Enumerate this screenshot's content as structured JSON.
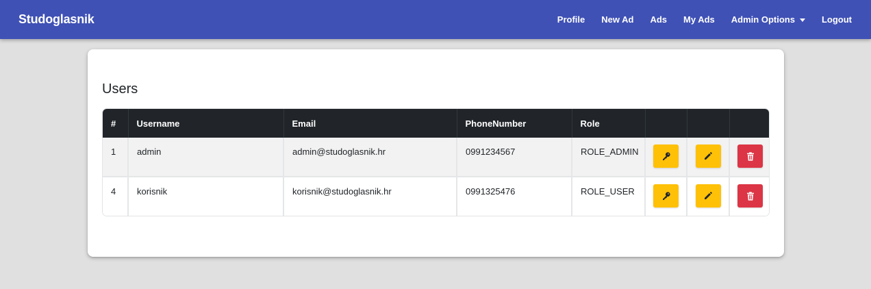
{
  "navbar": {
    "brand": "Studoglasnik",
    "links": [
      {
        "label": "Profile"
      },
      {
        "label": "New Ad"
      },
      {
        "label": "Ads"
      },
      {
        "label": "My Ads"
      },
      {
        "label": "Admin Options"
      },
      {
        "label": "Logout"
      }
    ],
    "color": "#3f51b5"
  },
  "page": {
    "title": "Users"
  },
  "table": {
    "headers": [
      "#",
      "Username",
      "Email",
      "PhoneNumber",
      "Role",
      "",
      "",
      ""
    ],
    "rows": [
      {
        "id": "1",
        "username": "admin",
        "email": "admin@studoglasnik.hr",
        "phone": "0991234567",
        "role": "ROLE_ADMIN"
      },
      {
        "id": "4",
        "username": "korisnik",
        "email": "korisnik@studoglasnik.hr",
        "phone": "0991325476",
        "role": "ROLE_USER"
      }
    ],
    "actions": [
      {
        "icon": "key-icon",
        "color": "#ffc107"
      },
      {
        "icon": "pencil-icon",
        "color": "#ffc107"
      },
      {
        "icon": "trash-icon",
        "color": "#dc3545"
      }
    ],
    "header_color": "#212529"
  }
}
